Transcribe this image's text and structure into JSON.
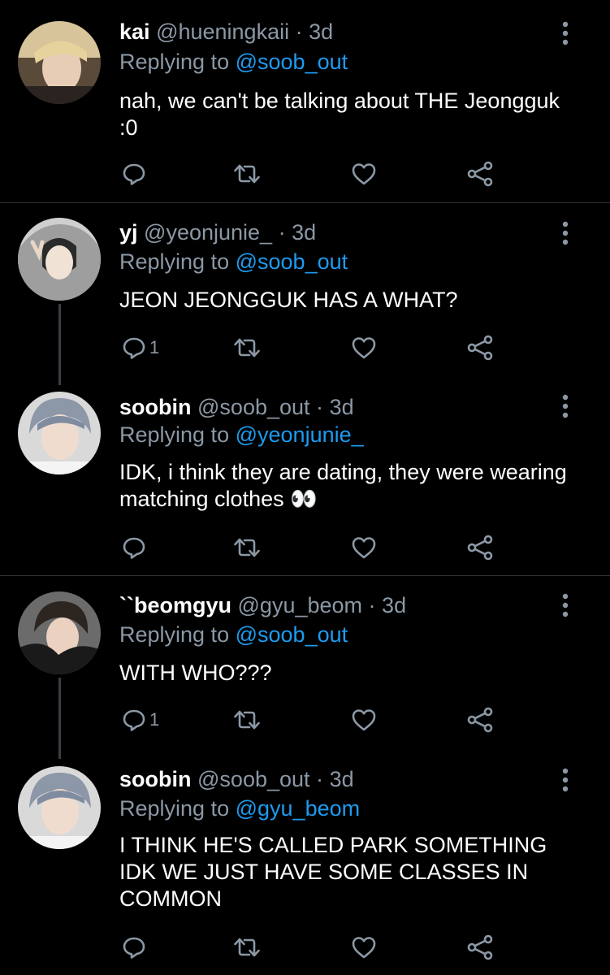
{
  "tweets": [
    {
      "name": "kai",
      "handle": "@hueningkaii",
      "dot": "·",
      "time": "3d",
      "replying_prefix": "Replying to",
      "replying_to": "@soob_out",
      "text": "nah, we can't be talking about THE Jeongguk :0",
      "reply_count": "",
      "avatar_icon": "avatar-photo"
    },
    {
      "name": "yj",
      "handle": "@yeonjunie_",
      "dot": "·",
      "time": "3d",
      "replying_prefix": "Replying to",
      "replying_to": "@soob_out",
      "text": "JEON JEONGGUK HAS A WHAT?",
      "reply_count": "1",
      "avatar_icon": "avatar-photo"
    },
    {
      "name": "soobin",
      "handle": "@soob_out",
      "dot": "·",
      "time": "3d",
      "replying_prefix": "Replying to",
      "replying_to": "@yeonjunie_",
      "text": "IDK, i think they are dating, they were wearing matching clothes 👀",
      "reply_count": "",
      "avatar_icon": "avatar-photo"
    },
    {
      "name": "``beomgyu",
      "handle": "@gyu_beom",
      "dot": "·",
      "time": "3d",
      "replying_prefix": "Replying to",
      "replying_to": "@soob_out",
      "text": "WITH WHO???",
      "reply_count": "1",
      "avatar_icon": "avatar-photo"
    },
    {
      "name": "soobin",
      "handle": "@soob_out",
      "dot": "·",
      "time": "3d",
      "replying_prefix": "Replying to",
      "replying_to": "@gyu_beom",
      "text": "I THINK HE'S CALLED PARK SOMETHING IDK WE JUST HAVE SOME CLASSES IN COMMON",
      "reply_count": "",
      "avatar_icon": "avatar-photo"
    }
  ],
  "colors": {
    "background": "#000000",
    "text": "#ffffff",
    "secondary": "#8b98a5",
    "mention": "#1d9bf0",
    "divider": "#2f3336",
    "thread_line": "#3a3f45"
  },
  "icons": {
    "reply": "reply-icon",
    "retweet": "retweet-icon",
    "like": "heart-icon",
    "share": "share-icon",
    "more": "more-vertical-icon"
  }
}
